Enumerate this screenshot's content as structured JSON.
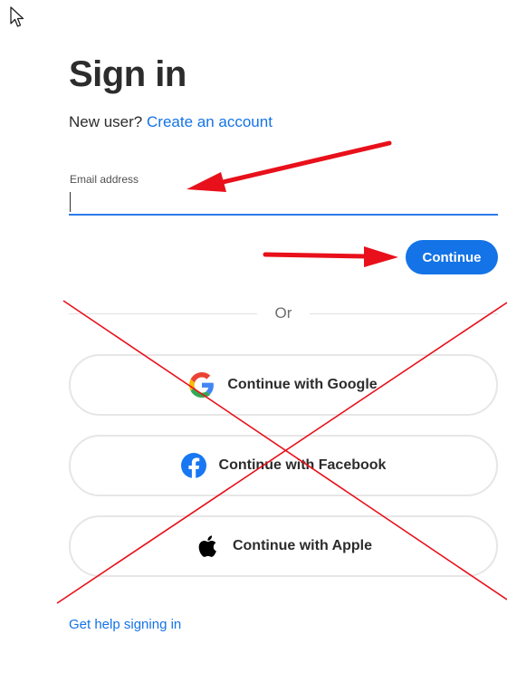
{
  "header": {
    "title": "Sign in",
    "new_user_prefix": "New user?",
    "create_account_link": "Create an account"
  },
  "email": {
    "label": "Email address",
    "value": ""
  },
  "continue_button": {
    "label": "Continue"
  },
  "divider": {
    "text": "Or"
  },
  "social": {
    "google_label": "Continue with Google",
    "facebook_label": "Continue with Facebook",
    "apple_label": "Continue with Apple"
  },
  "help": {
    "link": "Get help signing in"
  },
  "colors": {
    "accent": "#1473e6",
    "annotation_red": "#e8101a",
    "google_blue": "#4285f4",
    "google_red": "#ea4335",
    "google_yellow": "#fbbc05",
    "google_green": "#34a853",
    "facebook_blue": "#1877f2"
  },
  "icons": [
    "cursor-icon",
    "google-icon",
    "facebook-icon",
    "apple-icon"
  ],
  "annotations": [
    "arrow-to-email-field",
    "arrow-to-continue-button",
    "cross-over-social-options"
  ]
}
